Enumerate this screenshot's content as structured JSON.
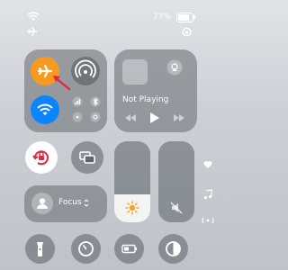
{
  "status_bar": {
    "battery_percent": "77%",
    "battery_level": 0.77,
    "icons": [
      "wifi-icon",
      "airplane-icon",
      "battery-icon",
      "orientation-lock-icon"
    ]
  },
  "connectivity": {
    "airplane_mode": "on",
    "wifi": "on",
    "accent_orange": "#f79a1d",
    "accent_blue": "#0a84ff"
  },
  "media": {
    "status": "Not Playing"
  },
  "focus": {
    "label": "Focus"
  },
  "sliders": {
    "brightness_level": 0.35,
    "volume_level": 0.0
  },
  "side_icons": [
    "heart-icon",
    "music-note-icon",
    "antenna-icon"
  ],
  "bottom_row_icons": [
    "flashlight-icon",
    "timer-icon",
    "battery-mode-icon",
    "dark-mode-icon"
  ]
}
